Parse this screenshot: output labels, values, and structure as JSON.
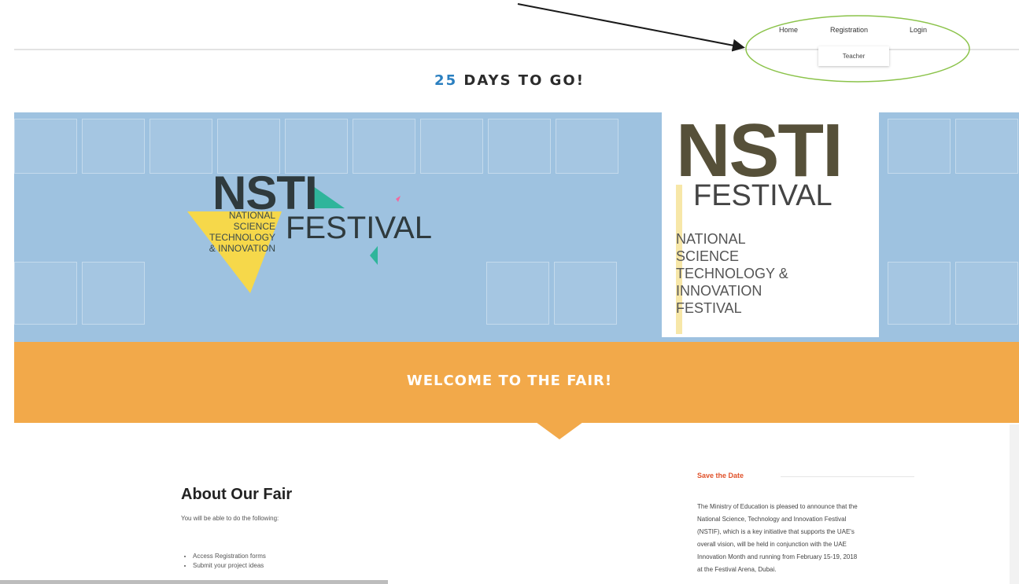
{
  "nav": {
    "home": "Home",
    "registration": "Registration",
    "login": "Login",
    "dropdown_item": "Teacher"
  },
  "countdown": {
    "number": "25",
    "text": "DAYS TO GO!"
  },
  "banner": {
    "logo1": {
      "title": "NSTI",
      "subtitle": "FESTIVAL",
      "lines": [
        "NATIONAL",
        "SCIENCE",
        "TECHNOLOGY",
        "& INNOVATION"
      ]
    },
    "logo2": {
      "title": "NSTI",
      "subtitle": "FESTIVAL",
      "lines": [
        "NATIONAL",
        "SCIENCE",
        "TECHNOLOGY &",
        "INNOVATION",
        "FESTIVAL"
      ]
    }
  },
  "welcome": "WELCOME TO THE FAIR!",
  "about": {
    "title": "About Our Fair",
    "intro": "You will be able to do the following:",
    "items": [
      "Access Registration forms",
      "Submit your project ideas"
    ]
  },
  "save_the_date": {
    "title": "Save the Date",
    "lines": [
      "The Ministry of Education is pleased to announce that the",
      "National Science, Technology and Innovation Festival",
      "(NSTIF), which is a key initiative that supports the UAE's",
      "overall vision, will be held in conjunction with the UAE",
      "Innovation Month and running from February 15-19, 2018",
      "at the Festival Arena, Dubai."
    ]
  },
  "colors": {
    "accent_blue": "#2a7fc0",
    "banner_blue": "#9ec2e0",
    "welcome_orange": "#f2a94a",
    "save_red": "#e0522b",
    "annotation_green": "#8bc34a"
  }
}
